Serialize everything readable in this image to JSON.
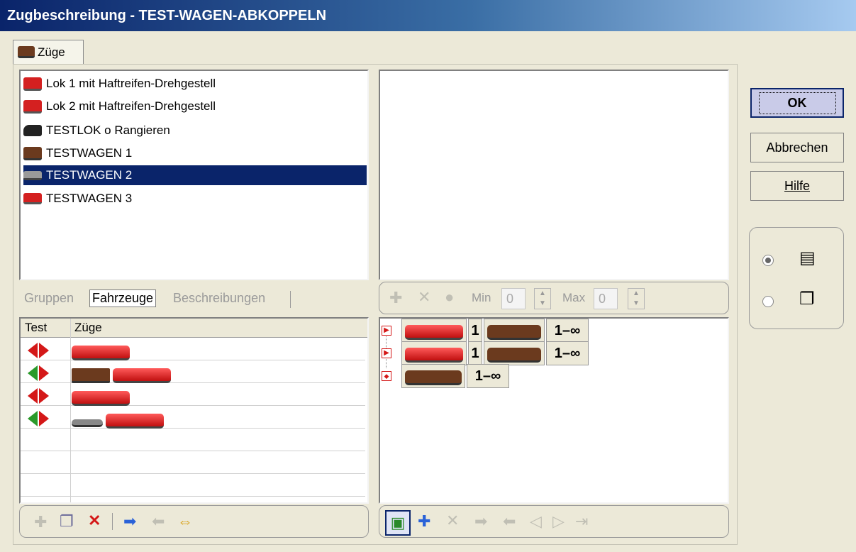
{
  "window": {
    "title": "Zugbeschreibung - TEST-WAGEN-ABKOPPELN"
  },
  "tabs": [
    {
      "label": "Züge",
      "icon": "train-icon"
    }
  ],
  "vehicle_list": {
    "items": [
      {
        "label": "Lok 1 mit Haftreifen-Drehgestell",
        "icon": "red-railcar-icon",
        "selected": false
      },
      {
        "label": "Lok 2 mit Haftreifen-Drehgestell",
        "icon": "red-railcar-icon",
        "selected": false
      },
      {
        "label": "TESTLOK o Rangieren",
        "icon": "steam-loco-icon",
        "selected": false
      },
      {
        "label": "TESTWAGEN 1",
        "icon": "brown-wagon-icon",
        "selected": false
      },
      {
        "label": "TESTWAGEN 2",
        "icon": "flat-wagon-icon",
        "selected": true
      },
      {
        "label": "TESTWAGEN 3",
        "icon": "red-wagon-icon",
        "selected": false
      }
    ]
  },
  "lower_tabs": {
    "groups": "Gruppen",
    "vehicles": "Fahrzeuge",
    "descriptions": "Beschreibungen",
    "active": "Fahrzeuge"
  },
  "trains_table": {
    "columns": [
      "Test",
      "Züge"
    ],
    "rows": [
      {
        "signal": "red",
        "cars": [
          "red-railcar"
        ]
      },
      {
        "signal": "green",
        "cars": [
          "brown-wagon",
          "red-railcar"
        ]
      },
      {
        "signal": "red",
        "cars": [
          "red-railcar"
        ]
      },
      {
        "signal": "green",
        "cars": [
          "flat-wagon",
          "red-railcar"
        ]
      }
    ]
  },
  "minmax": {
    "min_label": "Min",
    "min_value": "0",
    "max_label": "Max",
    "max_value": "0"
  },
  "composition_rows": [
    {
      "count": "1",
      "range": "1–∞"
    },
    {
      "count": "1",
      "range": "1–∞"
    },
    {
      "range": "1–∞"
    }
  ],
  "buttons": {
    "ok": "OK",
    "cancel": "Abbrechen",
    "help": "Hilfe"
  },
  "view_options": {
    "selected": "list"
  },
  "colors": {
    "selection": "#0a246a",
    "titlebar": "#0a246a",
    "signal_red": "#d41818",
    "signal_green": "#2a9a2a"
  }
}
